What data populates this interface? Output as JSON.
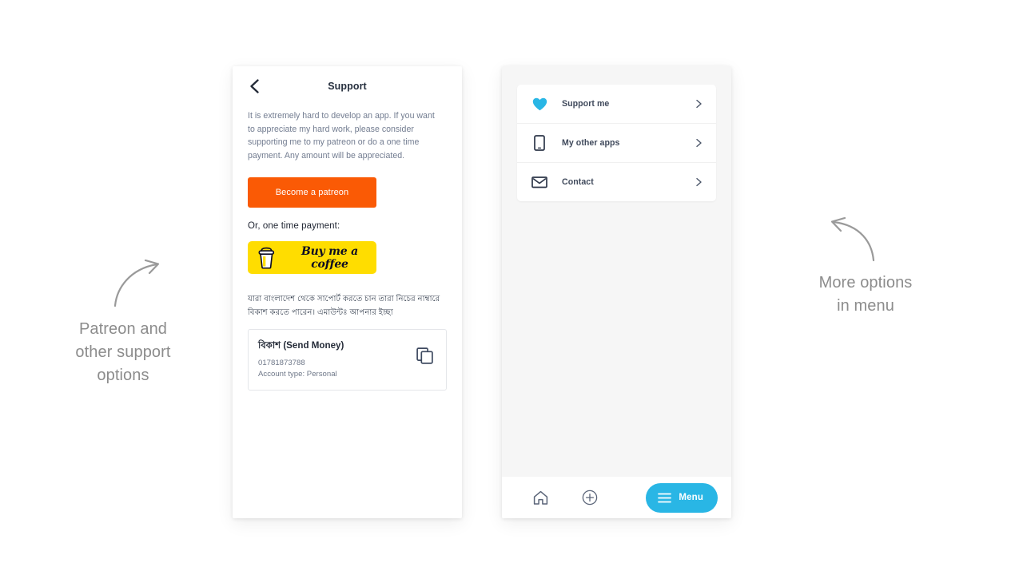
{
  "annotations": {
    "left": "Patreon and\nother support\noptions",
    "left_line1": "Patreon and",
    "left_line2": "other support",
    "left_line3": "options",
    "right_line1": "More options",
    "right_line2": "in menu"
  },
  "support_screen": {
    "back_icon": "chevron-left-icon",
    "title": "Support",
    "intro": "It is extremely hard to develop an app. If you want to appreciate my hard work, please consider supporting me to my patreon or do a one time payment. Any amount will be appreciated.",
    "patreon_button": "Become a patreon",
    "patreon_color": "#fa5a05",
    "onetime_label": "Or, one time payment:",
    "bmc_button": "Buy me a coffee",
    "bmc_color": "#ffdd00",
    "bangla_note": "যারা বাংলাদেশ থেকে সাপোর্ট করতে চান তারা নিচের নাম্বারে বিকাশ করতে পারেন। এমাউন্টঃ আপনার ইচ্ছা",
    "bkash_card": {
      "title": "বিকাশ (Send Money)",
      "number": "01781873788",
      "account_type": "Account type: Personal",
      "copy_icon": "copy-icon"
    }
  },
  "menu_screen": {
    "items": [
      {
        "label": "Support me",
        "icon": "heart-icon",
        "icon_color": "#29b6e5",
        "chevron": "chevron-right-icon"
      },
      {
        "label": "My other apps",
        "icon": "phone-icon",
        "icon_color": "#2c3548",
        "chevron": "chevron-right-icon"
      },
      {
        "label": "Contact",
        "icon": "envelope-icon",
        "icon_color": "#2c3548",
        "chevron": "chevron-right-icon"
      }
    ],
    "bottom_bar": {
      "home_icon": "home-icon",
      "add_icon": "plus-circle-icon",
      "menu_button": "Menu",
      "menu_icon": "hamburger-icon",
      "menu_color": "#29b6e5"
    }
  }
}
